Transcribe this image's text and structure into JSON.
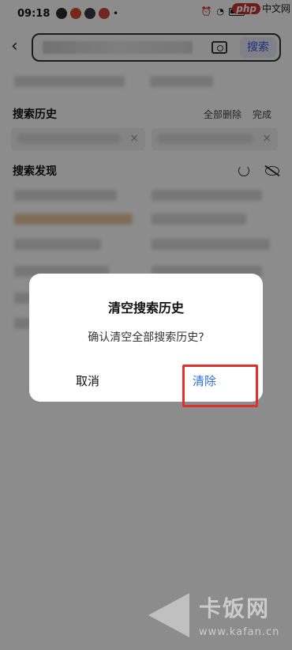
{
  "status_bar": {
    "time": "09:18"
  },
  "watermark_top": {
    "php_label": "php",
    "cn_label": "中文网"
  },
  "search": {
    "button_label": "搜索",
    "camera_icon": "camera-icon"
  },
  "history": {
    "title": "搜索历史",
    "clear_all_label": "全部删除",
    "done_label": "完成"
  },
  "discover": {
    "title": "搜索发现"
  },
  "dialog": {
    "title": "清空搜索历史",
    "message": "确认清空全部搜索历史?",
    "cancel_label": "取消",
    "confirm_label": "清除"
  },
  "watermark_bottom": {
    "cn_label": "卡饭网",
    "url": "www.kafan.cn"
  },
  "colors": {
    "accent": "#3e56d6",
    "confirm": "#2e6fdf",
    "highlight": "#e0302a"
  }
}
